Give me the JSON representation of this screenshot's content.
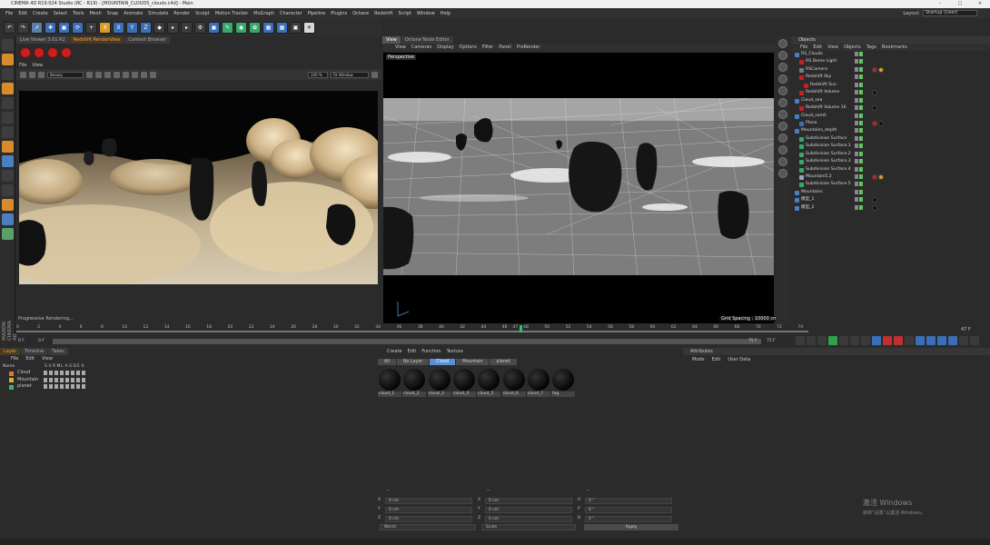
{
  "window": {
    "title": "CINEMA 4D R19.024 Studio (RC - R19) - [MOUNTAIN_CLOUDS_clouds.c4d] - Main"
  },
  "menu": [
    "File",
    "Edit",
    "Create",
    "Select",
    "Tools",
    "Mesh",
    "Snap",
    "Animate",
    "Simulate",
    "Render",
    "Sculpt",
    "Motion Tracker",
    "MoGraph",
    "Character",
    "Pipeline",
    "Plugins",
    "Octane",
    "Redshift",
    "Script",
    "Window",
    "Help"
  ],
  "layout": {
    "label": "Layout:",
    "value": "Startup (User)"
  },
  "render_view": {
    "tabs": [
      "Live Viewer 3.01 R2",
      "Redshift RenderView",
      "Content Browser"
    ],
    "menu": [
      "File",
      "View"
    ],
    "mode": "Beauty",
    "zoom": "100 %",
    "fit": "Fit Window",
    "status": "Progressive Rendering..."
  },
  "viewport": {
    "tabs": [
      "View",
      "Octane Node Editor"
    ],
    "menu": [
      "View",
      "Cameras",
      "Display",
      "Options",
      "Filter",
      "Panel",
      "ProRender"
    ],
    "label": "Perspective",
    "grid_spacing": "Grid Spacing : 10000 cm"
  },
  "objects": {
    "header": "Objects",
    "menu": [
      "File",
      "Edit",
      "View",
      "Objects",
      "Tags",
      "Bookmarks"
    ],
    "rows": [
      {
        "name": "RS_Clouds",
        "depth": 0,
        "icon": "layer",
        "flags": 2,
        "tags": ""
      },
      {
        "name": "RS Dome Light",
        "depth": 1,
        "icon": "red",
        "flags": 2,
        "tags": ""
      },
      {
        "name": "RSCamera",
        "depth": 1,
        "icon": "cam",
        "flags": 2,
        "tags": "ro"
      },
      {
        "name": "Redshift Sky",
        "depth": 1,
        "icon": "red",
        "flags": 2,
        "tags": ""
      },
      {
        "name": "Redshift Sun",
        "depth": 2,
        "icon": "red",
        "flags": 2,
        "tags": ""
      },
      {
        "name": "Redshift Volume",
        "depth": 1,
        "icon": "red",
        "flags": 2,
        "tags": "k"
      },
      {
        "name": "Cloud_sea",
        "depth": 0,
        "icon": "layer",
        "flags": 2,
        "tags": ""
      },
      {
        "name": "Redshift Volume 16",
        "depth": 1,
        "icon": "red",
        "flags": 2,
        "tags": "k"
      },
      {
        "name": "Cloud_samll",
        "depth": 0,
        "icon": "layer",
        "flags": 2,
        "tags": ""
      },
      {
        "name": "Plane",
        "depth": 1,
        "icon": "blue",
        "flags": 2,
        "tags": "rk"
      },
      {
        "name": "Mountains_depth",
        "depth": 0,
        "icon": "layer",
        "flags": 2,
        "tags": ""
      },
      {
        "name": "Subdivision Surface",
        "depth": 1,
        "icon": "green",
        "flags": 2,
        "tags": ""
      },
      {
        "name": "Subdivision Surface.1",
        "depth": 1,
        "icon": "green",
        "flags": 2,
        "tags": ""
      },
      {
        "name": "Subdivision Surface.2",
        "depth": 1,
        "icon": "green",
        "flags": 2,
        "tags": ""
      },
      {
        "name": "Subdivision Surface.3",
        "depth": 1,
        "icon": "green",
        "flags": 2,
        "tags": ""
      },
      {
        "name": "Subdivision Surface.4",
        "depth": 1,
        "icon": "green",
        "flags": 2,
        "tags": ""
      },
      {
        "name": "Mountain5.2",
        "depth": 1,
        "icon": "tri",
        "flags": 2,
        "tags": "ro"
      },
      {
        "name": "Subdivision Surface.5",
        "depth": 1,
        "icon": "green",
        "flags": 2,
        "tags": ""
      },
      {
        "name": "Mountains",
        "depth": 0,
        "icon": "layer",
        "flags": 2,
        "tags": ""
      },
      {
        "name": "模型_1",
        "depth": 0,
        "icon": "layer",
        "flags": 2,
        "tags": "k"
      },
      {
        "name": "模型_2",
        "depth": 0,
        "icon": "layer",
        "flags": 2,
        "tags": "k"
      }
    ]
  },
  "timeline": {
    "ticks": [
      "0",
      "2",
      "4",
      "6",
      "8",
      "10",
      "12",
      "14",
      "16",
      "18",
      "20",
      "22",
      "24",
      "26",
      "28",
      "30",
      "32",
      "34",
      "36",
      "38",
      "40",
      "42",
      "44",
      "46",
      "47",
      "48",
      "50",
      "52",
      "54",
      "56",
      "58",
      "60",
      "62",
      "64",
      "66",
      "68",
      "70",
      "72",
      "74"
    ],
    "current_frame": "47 F",
    "range_start": "0 F",
    "range_start2": "0 F",
    "range_end": "75 F",
    "range_end2": "75 F",
    "playhead_fraction": 0.635
  },
  "layers": {
    "tabs": [
      "Layer",
      "Timeline",
      "Takes"
    ],
    "menu": [
      "File",
      "Edit",
      "View"
    ],
    "columns": [
      "Name",
      "S",
      "V",
      "R",
      "M",
      "L",
      "A",
      "G",
      "D",
      "E",
      "X"
    ],
    "rows": [
      {
        "name": "Cloud",
        "color": "#e07a2a"
      },
      {
        "name": "Mountain",
        "color": "#e0b02a"
      },
      {
        "name": "planet",
        "color": "#3ab56e"
      }
    ]
  },
  "materials": {
    "menu": [
      "Create",
      "Edit",
      "Function",
      "Texture"
    ],
    "filters": [
      "All",
      "No Layer",
      "Cloud",
      "Mountain",
      "planet"
    ],
    "active_filter": "Cloud",
    "items": [
      "cloud_1",
      "cloud_2",
      "cloud_3",
      "cloud_4",
      "cloud_5",
      "cloud_6",
      "cloud_7",
      "fog"
    ]
  },
  "coords": {
    "header": [
      "--",
      "--",
      "--"
    ],
    "rows": [
      {
        "a": "X",
        "av": "0 cm",
        "b": "X",
        "bv": "0 cm",
        "c": "H",
        "cv": "0 °"
      },
      {
        "a": "Y",
        "av": "0 cm",
        "b": "Y",
        "bv": "0 cm",
        "c": "P",
        "cv": "0 °"
      },
      {
        "a": "Z",
        "av": "0 cm",
        "b": "Z",
        "bv": "0 cm",
        "c": "B",
        "cv": "0 °"
      }
    ],
    "space": "World",
    "scale": "Scale",
    "apply": "Apply"
  },
  "attributes": {
    "header": "Attributes",
    "menu": [
      "Mode",
      "Edit",
      "User Data"
    ]
  },
  "watermark": {
    "line1": "激活 Windows",
    "line2": "转到“设置”以激活 Windows。"
  },
  "maxon": "MAXON CINEMA 4D",
  "colors": {
    "accent_blue": "#3a6fb8",
    "render_red": "#c62020",
    "playhead_green": "#29c56a"
  }
}
